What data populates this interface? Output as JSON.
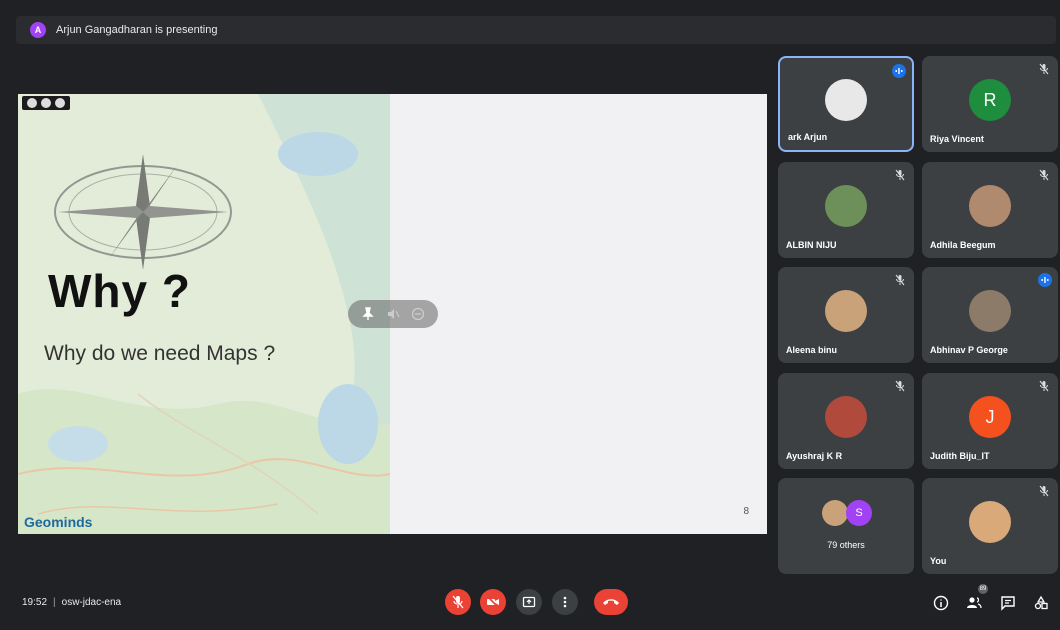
{
  "presenting": {
    "avatar_letter": "A",
    "text": "Arjun Gangadharan is presenting"
  },
  "slide": {
    "title": "Why ?",
    "subtitle": "Why do we need Maps ?",
    "brand": "Geominds",
    "page_number": "8"
  },
  "participants": [
    {
      "name": "ark Arjun",
      "avatar_letter": "",
      "avatar_color": "#e8e8e8",
      "speaking": true,
      "muted": false
    },
    {
      "name": "Riya Vincent",
      "avatar_letter": "R",
      "avatar_color": "#1e8e3e",
      "speaking": false,
      "muted": true
    },
    {
      "name": "ALBIN NIJU",
      "avatar_letter": "",
      "avatar_color": "#6d8f5a",
      "speaking": false,
      "muted": true
    },
    {
      "name": "Adhila Beegum",
      "avatar_letter": "",
      "avatar_color": "#b08a6e",
      "speaking": false,
      "muted": true
    },
    {
      "name": "Aleena binu",
      "avatar_letter": "",
      "avatar_color": "#c9a27a",
      "speaking": false,
      "muted": true
    },
    {
      "name": "Abhinav P George",
      "avatar_letter": "",
      "avatar_color": "#8c7b68",
      "speaking": true,
      "muted": false
    },
    {
      "name": "Ayushraj K R",
      "avatar_letter": "",
      "avatar_color": "#b04a3c",
      "speaking": false,
      "muted": true
    },
    {
      "name": "Judith Biju_IT",
      "avatar_letter": "J",
      "avatar_color": "#f4511e",
      "speaking": false,
      "muted": true
    },
    {
      "name": "You",
      "avatar_letter": "",
      "avatar_color": "#d9a97a",
      "speaking": false,
      "muted": true
    }
  ],
  "others": {
    "label": "79 others",
    "avatar_letter": "S",
    "avatar_color": "#a142f4"
  },
  "meeting": {
    "time": "19:52",
    "separator": "|",
    "code": "osw-jdac-ena",
    "people_count": "89"
  },
  "colors": {
    "background": "#202124",
    "tile": "#3c4043",
    "danger": "#ea4335",
    "active_border": "#8ab4f8"
  }
}
